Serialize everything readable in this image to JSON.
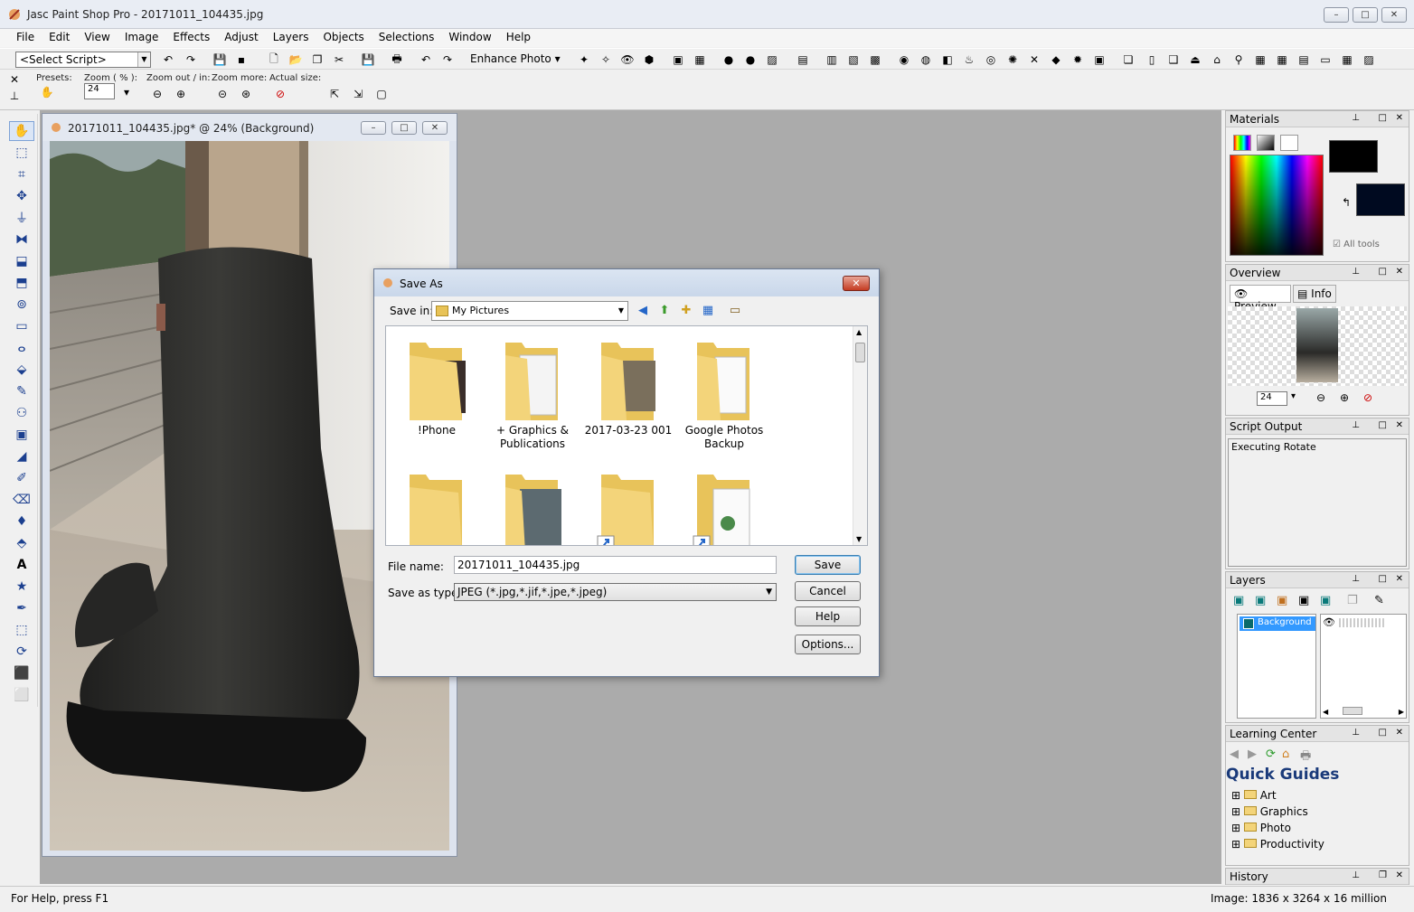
{
  "window": {
    "title": "Jasc Paint Shop Pro - 20171011_104435.jpg",
    "min": "–",
    "max": "□",
    "close": "✕"
  },
  "menu": [
    "File",
    "Edit",
    "View",
    "Image",
    "Effects",
    "Adjust",
    "Layers",
    "Objects",
    "Selections",
    "Window",
    "Help"
  ],
  "toolbar": {
    "script_select": "<Select Script>",
    "enhance_photo": "Enhance Photo"
  },
  "tool_options": {
    "presets_label": "Presets:",
    "zoom_label": "Zoom ( % ):",
    "zoom_value": "24",
    "zoom_out_in_label": "Zoom out / in:",
    "zoom_more_label": "Zoom more:",
    "actual_size_label": "Actual size:"
  },
  "image_window": {
    "title": "20171011_104435.jpg* @  24% (Background)"
  },
  "dialog": {
    "title": "Save As",
    "save_in_label": "Save in:",
    "save_in_value": "My Pictures",
    "folders": [
      {
        "label": "!Phone"
      },
      {
        "label": "+ Graphics & Publications"
      },
      {
        "label": "2017-03-23 001"
      },
      {
        "label": "Google Photos Backup"
      },
      {
        "label": ""
      },
      {
        "label": ""
      },
      {
        "label": ""
      },
      {
        "label": ""
      }
    ],
    "file_name_label": "File name:",
    "file_name_value": "20171011_104435.jpg",
    "save_type_label": "Save as type:",
    "save_type_value": "JPEG  (*.jpg,*.jif,*.jpe,*.jpeg)",
    "buttons": {
      "save": "Save",
      "cancel": "Cancel",
      "help": "Help",
      "options": "Options..."
    }
  },
  "panels": {
    "materials": {
      "title": "Materials",
      "all_tools": "All tools"
    },
    "overview": {
      "title": "Overview",
      "tab_preview": "Preview",
      "tab_info": "Info",
      "zoom_value": "24"
    },
    "script_output": {
      "title": "Script Output",
      "text": "Executing Rotate"
    },
    "layers": {
      "title": "Layers",
      "layer_name": "Background"
    },
    "learning_center": {
      "title": "Learning Center",
      "heading": "Quick Guides",
      "items": [
        "Art",
        "Graphics",
        "Photo",
        "Productivity"
      ]
    },
    "history": {
      "title": "History"
    }
  },
  "status": {
    "help": "For Help, press F1",
    "image_info": "Image:  1836 x 3264 x 16 million"
  },
  "colors": {
    "workspace": "#ababab",
    "selection": "#3399ff",
    "folder": "#f3d47a"
  }
}
